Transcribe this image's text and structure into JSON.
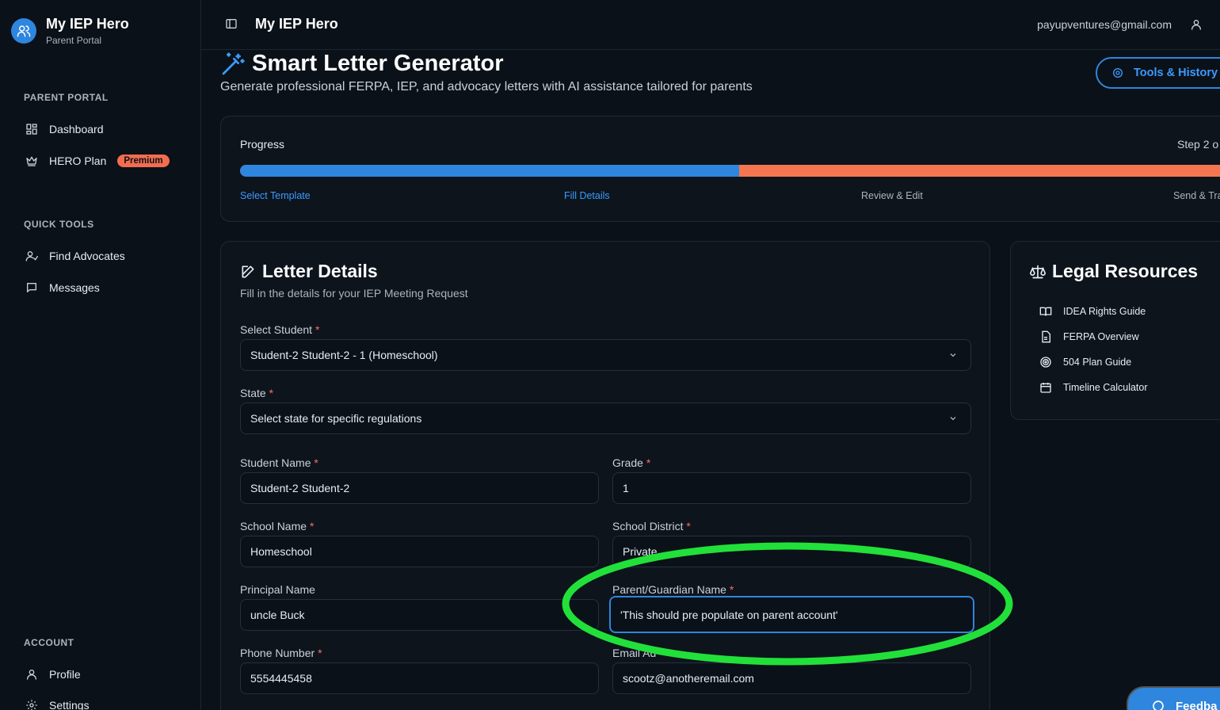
{
  "sidebar": {
    "brand_title": "My IEP Hero",
    "brand_subtitle": "Parent Portal",
    "sections": {
      "parent_portal": "PARENT PORTAL",
      "quick_tools": "QUICK TOOLS",
      "account": "ACCOUNT"
    },
    "items": {
      "dashboard": "Dashboard",
      "hero_plan": "HERO Plan",
      "premium_badge": "Premium",
      "find_advocates": "Find Advocates",
      "messages": "Messages",
      "profile": "Profile",
      "settings": "Settings"
    }
  },
  "header": {
    "title": "My IEP Hero",
    "email": "payupventures@gmail.com"
  },
  "page": {
    "title": "Smart Letter Generator",
    "subtitle": "Generate professional FERPA, IEP, and advocacy letters with AI assistance tailored for parents",
    "tools_button": "Tools & History"
  },
  "progress": {
    "label": "Progress",
    "step_text": "Step 2 o",
    "fraction_complete": 0.5,
    "steps": [
      "Select Template",
      "Fill Details",
      "Review & Edit",
      "Send & Tra"
    ]
  },
  "details": {
    "title": "Letter Details",
    "subtitle": "Fill in the details for your IEP Meeting Request",
    "fields": {
      "student_select": {
        "label": "Select Student",
        "value": "Student-2 Student-2 - 1 (Homeschool)"
      },
      "state": {
        "label": "State",
        "value": "Select state for specific regulations"
      },
      "student_name": {
        "label": "Student Name",
        "value": "Student-2 Student-2"
      },
      "grade": {
        "label": "Grade",
        "value": "1"
      },
      "school_name": {
        "label": "School Name",
        "value": "Homeschool"
      },
      "school_district": {
        "label": "School District",
        "value": "Private"
      },
      "principal_name": {
        "label": "Principal Name",
        "value": "uncle Buck"
      },
      "parent_name": {
        "label": "Parent/Guardian Name",
        "value": "'This should pre populate on parent account'"
      },
      "phone": {
        "label": "Phone Number",
        "value": "5554445458"
      },
      "email": {
        "label": "Email Ad",
        "value": "scootz@anotheremail.com"
      }
    },
    "required_mark": "*"
  },
  "legal": {
    "title": "Legal Resources",
    "items": [
      "IDEA Rights Guide",
      "FERPA Overview",
      "504 Plan Guide",
      "Timeline Calculator"
    ]
  },
  "feedback": {
    "label": "Feedba"
  },
  "colors": {
    "accent": "#2e86de",
    "progress_remaining": "#f47650",
    "premium_badge": "#f26d4f",
    "annotation": "#22e03a"
  }
}
